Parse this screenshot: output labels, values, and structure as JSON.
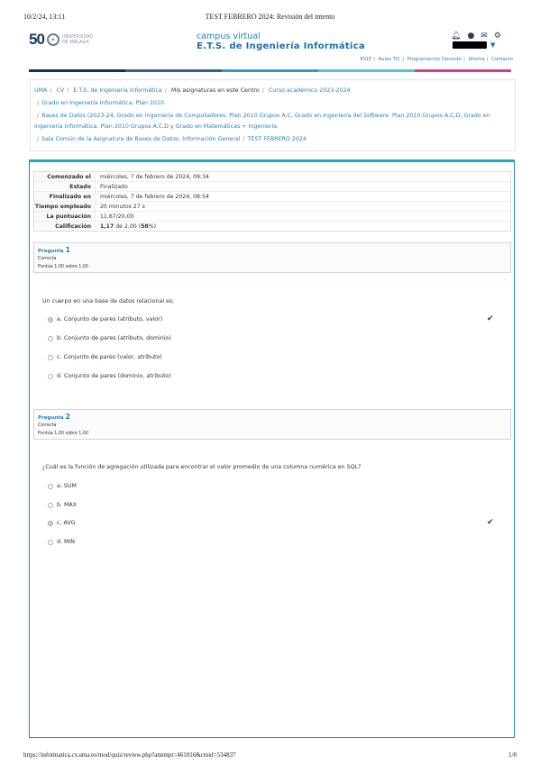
{
  "print": {
    "date": "10/2/24, 13:11",
    "title": "TEST FEBRERO 2024: Revisión del intento",
    "url": "https://informatica.cv.uma.es/mod/quiz/review.php?attempt=461016&cmid=534837",
    "page": "1/8"
  },
  "logo": {
    "fifty": "50",
    "uni": "UNIVERSIDAD DE MÁLAGA"
  },
  "campus": {
    "small": "campus virtual",
    "big": "E.T.S. de Ingeniería Informática"
  },
  "top_links": [
    "EVLT",
    "Aulas TIC",
    "Programación Docente",
    "Idioma",
    "Contacto"
  ],
  "colors": {
    "bar": [
      "#1a2f55",
      "#3b5d8a",
      "#2aa0c9",
      "#55c1d6",
      "#d23c8c"
    ]
  },
  "breadcrumb": {
    "uma": "UMA",
    "cv": "CV",
    "ets": "E.T.S. de Ingeniería Informática",
    "mine": "Mis asignaturas en este Centro",
    "curso": "Curso académico 2023-2024",
    "grado": "Grado en Ingeniería Informática. Plan 2010",
    "bd": "Bases de Datos (2023-24, Grado en Ingeniería de Computadores. Plan 2010 Grupos A,C, Grado en Ingeniería del Software. Plan 2010 Grupos A,C,D, Grado en Ingeniería Informática. Plan 2010 Grupos A,C,D y Grado en Matemáticas + Ingeniería",
    "sala": "Sala Común de la Asignatura de Bases de Datos. Información General",
    "test": "TEST FEBRERO 2024"
  },
  "summary": [
    {
      "k": "Comenzado el",
      "v": "miércoles, 7 de febrero de 2024, 09:34"
    },
    {
      "k": "Estado",
      "v": "Finalizado"
    },
    {
      "k": "Finalizado en",
      "v": "miércoles, 7 de febrero de 2024, 09:54"
    },
    {
      "k": "Tiempo empleado",
      "v": "20 minutos 27 s"
    },
    {
      "k": "La puntuación",
      "v": "11,67/20,00"
    },
    {
      "k": "Calificación",
      "v_bold": "1,17",
      "v_mid": " de 2,00 (",
      "v_pct": "58",
      "v_end": "%)"
    }
  ],
  "q1": {
    "label": "Pregunta",
    "num": "1",
    "status": "Correcta",
    "points": "Puntúa 1,00 sobre 1,00",
    "text": "Un cuerpo en una base de datos relacional es:",
    "options": [
      "a. Conjunto de pares (atributo, valor)",
      "b. Conjunto de pares (atributo, dominio)",
      "c. Conjunto de pares (valor, atributo)",
      "d. Conjunto de pares (dominio, atributo)"
    ],
    "selected": 0
  },
  "q2": {
    "label": "Pregunta",
    "num": "2",
    "status": "Correcta",
    "points": "Puntúa 1,00 sobre 1,00",
    "text": "¿Cuál es la función de agregación utilizada para encontrar el valor promedio de una columna numérica en SQL?",
    "options": [
      "a. SUM",
      "b. MAX",
      "c. AVG",
      "d. MIN"
    ],
    "selected": 2
  }
}
